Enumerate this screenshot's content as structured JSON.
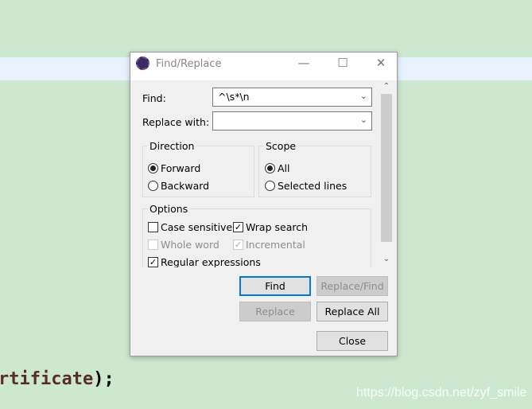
{
  "background": {
    "code_text": "rtificate",
    "code_suffix": ");",
    "watermark": "https://blog.csdn.net/zyf_smile"
  },
  "dialog": {
    "title": "Find/Replace",
    "find_label": "Find:",
    "find_value": "^\\s*\\n",
    "replace_label": "Replace with:",
    "replace_value": "",
    "direction": {
      "label": "Direction",
      "options": [
        "Forward",
        "Backward"
      ],
      "selected": "Forward"
    },
    "scope": {
      "label": "Scope",
      "options": [
        "All",
        "Selected lines"
      ],
      "selected": "All"
    },
    "options": {
      "label": "Options",
      "case_sensitive": "Case sensitive",
      "wrap_search": "Wrap search",
      "whole_word": "Whole word",
      "incremental": "Incremental",
      "regex": "Regular expressions",
      "checked": {
        "case_sensitive": false,
        "wrap_search": true,
        "whole_word": false,
        "incremental": true,
        "regex": true
      }
    },
    "buttons": {
      "find": "Find",
      "replace_find": "Replace/Find",
      "replace": "Replace",
      "replace_all": "Replace All",
      "close": "Close"
    }
  }
}
